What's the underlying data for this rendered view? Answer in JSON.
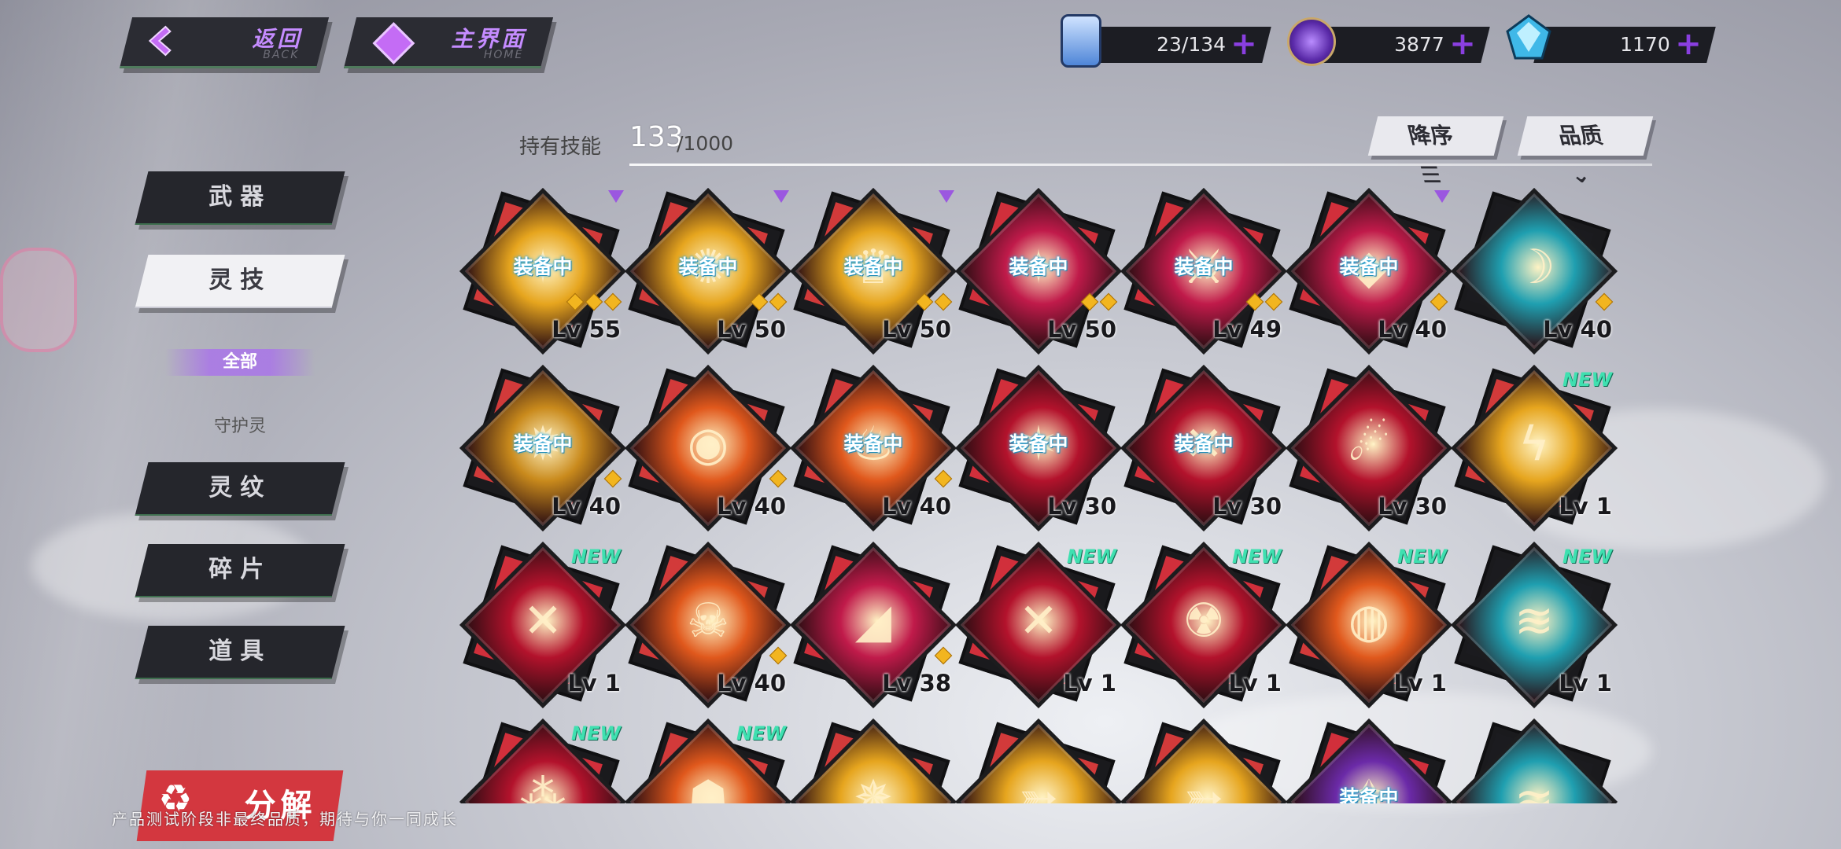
{
  "nav": {
    "back": {
      "label": "返回",
      "sub": "BACK"
    },
    "home": {
      "label": "主界面",
      "sub": "HOME"
    }
  },
  "currencies": [
    {
      "icon": "energy-drink-icon",
      "value": "23/134"
    },
    {
      "icon": "purple-coin-icon",
      "value": "3877"
    },
    {
      "icon": "blue-crystal-icon",
      "value": "1170"
    }
  ],
  "sidebar": {
    "tabs": [
      {
        "label": "武器"
      },
      {
        "label": "灵技"
      },
      {
        "label": "灵纹"
      },
      {
        "label": "碎片"
      },
      {
        "label": "道具"
      }
    ],
    "sub_filters": [
      {
        "label": "全部"
      },
      {
        "label": "守护灵"
      }
    ],
    "split_button": "分解"
  },
  "header": {
    "owned_label": "持有技能",
    "owned_count": "133",
    "owned_total": "/1000",
    "sort_label": "降序",
    "quality_label": "品质"
  },
  "equipped_text": "装备中",
  "new_text": "NEW",
  "skills": [
    {
      "level": "Lv 55",
      "equipped": true,
      "new": false,
      "stars": 3,
      "rarity": "gold",
      "marker": true
    },
    {
      "level": "Lv 50",
      "equipped": true,
      "new": false,
      "stars": 2,
      "rarity": "gold",
      "marker": true
    },
    {
      "level": "Lv 50",
      "equipped": true,
      "new": false,
      "stars": 2,
      "rarity": "gold",
      "marker": true
    },
    {
      "level": "Lv 50",
      "equipped": true,
      "new": false,
      "stars": 2,
      "rarity": "crimson",
      "marker": false
    },
    {
      "level": "Lv 49",
      "equipped": true,
      "new": false,
      "stars": 2,
      "rarity": "crimson",
      "marker": false
    },
    {
      "level": "Lv 40",
      "equipped": true,
      "new": false,
      "stars": 1,
      "rarity": "crimson",
      "marker": true
    },
    {
      "level": "Lv 40",
      "equipped": false,
      "new": false,
      "stars": 1,
      "rarity": "teal",
      "marker": false
    },
    {
      "level": "Lv 40",
      "equipped": true,
      "new": false,
      "stars": 1,
      "rarity": "amber",
      "marker": false
    },
    {
      "level": "Lv 40",
      "equipped": false,
      "new": false,
      "stars": 1,
      "rarity": "orange",
      "marker": false
    },
    {
      "level": "Lv 40",
      "equipped": true,
      "new": false,
      "stars": 1,
      "rarity": "orange",
      "marker": false
    },
    {
      "level": "Lv 30",
      "equipped": true,
      "new": false,
      "stars": 0,
      "rarity": "red",
      "marker": false
    },
    {
      "level": "Lv 30",
      "equipped": true,
      "new": false,
      "stars": 0,
      "rarity": "red",
      "marker": false
    },
    {
      "level": "Lv 30",
      "equipped": false,
      "new": false,
      "stars": 0,
      "rarity": "red",
      "marker": false
    },
    {
      "level": "Lv 1",
      "equipped": false,
      "new": true,
      "stars": 0,
      "rarity": "gold",
      "marker": false
    },
    {
      "level": "Lv 1",
      "equipped": false,
      "new": true,
      "stars": 0,
      "rarity": "red",
      "marker": false
    },
    {
      "level": "Lv 40",
      "equipped": false,
      "new": false,
      "stars": 1,
      "rarity": "orange",
      "marker": false
    },
    {
      "level": "Lv 38",
      "equipped": false,
      "new": false,
      "stars": 1,
      "rarity": "crimson",
      "marker": false
    },
    {
      "level": "Lv 1",
      "equipped": false,
      "new": true,
      "stars": 0,
      "rarity": "red",
      "marker": false
    },
    {
      "level": "Lv 1",
      "equipped": false,
      "new": true,
      "stars": 0,
      "rarity": "red",
      "marker": false
    },
    {
      "level": "Lv 1",
      "equipped": false,
      "new": true,
      "stars": 0,
      "rarity": "orange",
      "marker": false
    },
    {
      "level": "Lv 1",
      "equipped": false,
      "new": true,
      "stars": 0,
      "rarity": "teal",
      "marker": false
    },
    {
      "level": "",
      "equipped": false,
      "new": true,
      "stars": 0,
      "rarity": "red",
      "marker": false
    },
    {
      "level": "",
      "equipped": false,
      "new": true,
      "stars": 0,
      "rarity": "orange",
      "marker": false
    },
    {
      "level": "",
      "equipped": false,
      "new": false,
      "stars": 0,
      "rarity": "gold",
      "marker": false
    },
    {
      "level": "",
      "equipped": false,
      "new": false,
      "stars": 0,
      "rarity": "gold",
      "marker": false
    },
    {
      "level": "",
      "equipped": false,
      "new": false,
      "stars": 0,
      "rarity": "gold",
      "marker": false
    },
    {
      "level": "",
      "equipped": true,
      "new": false,
      "stars": 0,
      "rarity": "purple",
      "marker": false
    },
    {
      "level": "",
      "equipped": false,
      "new": false,
      "stars": 0,
      "rarity": "teal",
      "marker": false
    }
  ],
  "rarity_colors": {
    "gold": "#e6a51e",
    "amber": "#c98a1c",
    "orange": "#e0581c",
    "crimson": "#c01a4a",
    "red": "#b3122c",
    "teal": "#1f9fb0",
    "purple": "#6b2aa8"
  },
  "footer_note": "产品测试阶段非最终品质，期待与你一同成长"
}
